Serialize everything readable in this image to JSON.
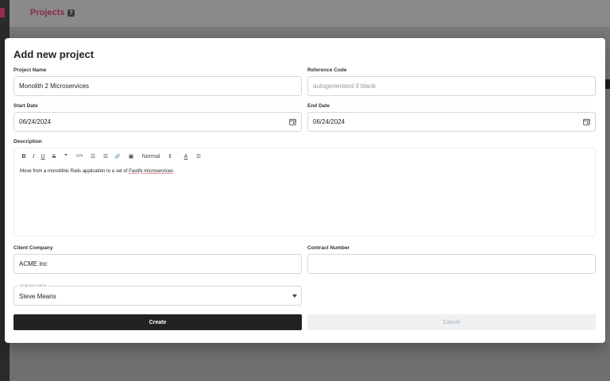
{
  "background": {
    "title": "Projects",
    "badge": "?"
  },
  "modal": {
    "title": "Add new project",
    "project_name": {
      "label": "Project Name",
      "value": "Monolith 2 Microservices"
    },
    "reference_code": {
      "label": "Reference Code",
      "placeholder": "autogenerated if blank"
    },
    "start_date": {
      "label": "Start Date",
      "value": "06/24/2024"
    },
    "end_date": {
      "label": "End Date",
      "value": "06/24/2024"
    },
    "description": {
      "label": "Description",
      "toolbar": {
        "bold": "B",
        "italic": "I",
        "underline": "U",
        "strike": "S",
        "quote": "❞",
        "code": "</>",
        "ordered_list": "☰",
        "bullet_list": "☰",
        "link": "🔗",
        "image": "▣",
        "font_size": "Normal",
        "font_size_caret": "⇕",
        "color": "A",
        "align": "☰"
      },
      "text_before": "Move from a monolithic Rails application to a set of ",
      "text_sq": "Fastify microservices"
    },
    "client_company": {
      "label": "Client Company",
      "value": "ACME inc"
    },
    "contract_number": {
      "label": "Contract Number",
      "value": ""
    },
    "employee": {
      "label": "Employee Name",
      "value": "Steve Means"
    },
    "create_label": "Create",
    "cancel_label": "Cancel"
  }
}
